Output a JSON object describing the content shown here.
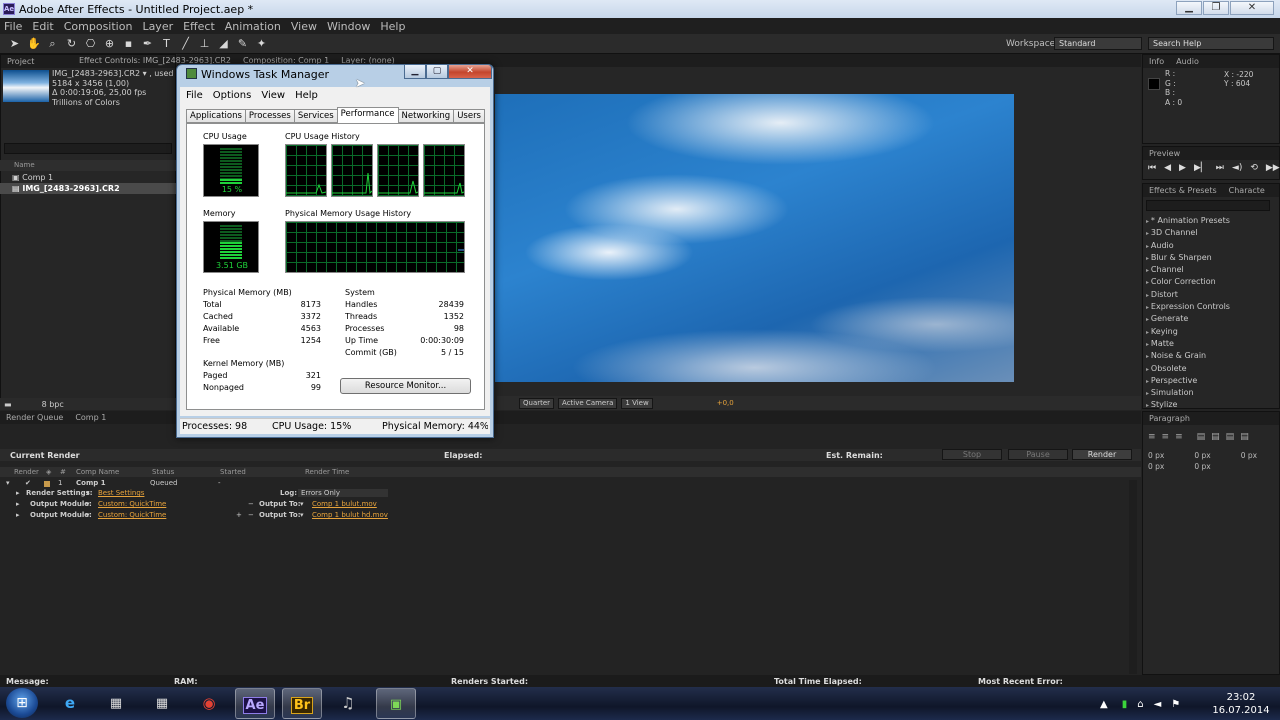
{
  "app": {
    "title": "Adobe After Effects - Untitled Project.aep *",
    "menu": [
      "File",
      "Edit",
      "Composition",
      "Layer",
      "Effect",
      "Animation",
      "View",
      "Window",
      "Help"
    ]
  },
  "toolbar": {
    "workspace_label": "Workspace:",
    "workspace_value": "Standard",
    "search_help": "Search Help"
  },
  "project": {
    "tab": "Project",
    "effect_controls_tab": "Effect Controls: IMG_[2483-2963].CR2",
    "composition_tab": "Composition: Comp 1",
    "layer_tab": "Layer: (none)",
    "file_name": "IMG_[2483-2963].CR2 ▾ , used 1",
    "file_dims": "5184 x 3456 (1,00)",
    "file_duration": "Δ 0:00:19:06, 25,00 fps",
    "file_colors": "Trillions of Colors",
    "list_header": "Name",
    "items": [
      {
        "label": "Comp 1",
        "selected": false
      },
      {
        "label": "IMG_[2483-2963].CR2",
        "selected": true
      }
    ],
    "bpc": "8 bpc"
  },
  "comp_bar": {
    "resolution": "Quarter",
    "camera": "Active Camera",
    "views": "1 View",
    "exposure": "+0,0"
  },
  "info": {
    "tab": "Info",
    "audio_tab": "Audio",
    "r": "R :",
    "g": "G :",
    "b": "B :",
    "a": "A : 0",
    "x": "X : -220",
    "y": "Y : 604"
  },
  "preview": {
    "tab": "Preview"
  },
  "effects": {
    "tab": "Effects & Presets",
    "char_tab": "Characte",
    "items": [
      "* Animation Presets",
      "3D Channel",
      "Audio",
      "Blur & Sharpen",
      "Channel",
      "Color Correction",
      "Distort",
      "Expression Controls",
      "Generate",
      "Keying",
      "Matte",
      "Noise & Grain",
      "Obsolete",
      "Perspective",
      "Simulation",
      "Stylize"
    ]
  },
  "paragraph": {
    "tab": "Paragraph",
    "values": [
      "0 px",
      "0 px",
      "0 px",
      "0 px",
      "0 px"
    ]
  },
  "render_queue": {
    "tab": "Render Queue",
    "comp_tab": "Comp 1",
    "current_render": "Current Render",
    "elapsed": "Elapsed:",
    "est_remain": "Est. Remain:",
    "stop": "Stop",
    "pause": "Pause",
    "render": "Render",
    "headers": [
      "Render",
      "#",
      "Comp Name",
      "Status",
      "Started",
      "Render Time"
    ],
    "item": {
      "num": "1",
      "comp": "Comp 1",
      "status": "Queued",
      "started": "-"
    },
    "render_settings_label": "Render Settings:",
    "render_settings_value": "Best Settings",
    "log_label": "Log:",
    "log_value": "Errors Only",
    "output_module_label": "Output Module:",
    "output_module_value": "Custom: QuickTime",
    "output_to_label": "Output To:",
    "output_to_1": "Comp 1 bulut.mov",
    "output_to_2": "Comp 1 bulut hd.mov"
  },
  "status": {
    "message": "Message:",
    "ram": "RAM:",
    "renders_started": "Renders Started:",
    "total_time": "Total Time Elapsed:",
    "recent_error": "Most Recent Error:"
  },
  "task_manager": {
    "title": "Windows Task Manager",
    "menu": [
      "File",
      "Options",
      "View",
      "Help"
    ],
    "tabs": [
      "Applications",
      "Processes",
      "Services",
      "Performance",
      "Networking",
      "Users"
    ],
    "active_tab": "Performance",
    "cpu_usage_label": "CPU Usage",
    "cpu_usage_value": "15 %",
    "cpu_usage_percent": 15,
    "cpu_history_label": "CPU Usage History",
    "memory_label": "Memory",
    "memory_value": "3.51 GB",
    "mem_history_label": "Physical Memory Usage History",
    "phys_mem_title": "Physical Memory (MB)",
    "phys_mem": [
      [
        "Total",
        "8173"
      ],
      [
        "Cached",
        "3372"
      ],
      [
        "Available",
        "4563"
      ],
      [
        "Free",
        "1254"
      ]
    ],
    "system_title": "System",
    "system": [
      [
        "Handles",
        "28439"
      ],
      [
        "Threads",
        "1352"
      ],
      [
        "Processes",
        "98"
      ],
      [
        "Up Time",
        "0:00:30:09"
      ],
      [
        "Commit (GB)",
        "5 / 15"
      ]
    ],
    "kernel_title": "Kernel Memory (MB)",
    "kernel": [
      [
        "Paged",
        "321"
      ],
      [
        "Nonpaged",
        "99"
      ]
    ],
    "resource_monitor": "Resource Monitor...",
    "status_processes": "Processes: 98",
    "status_cpu": "CPU Usage: 15%",
    "status_memory": "Physical Memory: 44%"
  },
  "taskbar": {
    "apps": [
      "ie-icon",
      "calculator-icon",
      "calculator-icon",
      "chrome-icon",
      "after-effects-icon",
      "bridge-icon",
      "media-icon",
      "task-manager-icon"
    ],
    "ae_label": "Ae",
    "br_label": "Br",
    "time": "23:02",
    "date": "16.07.2014"
  },
  "colors": {
    "ae_panel": "#262626",
    "ae_accent_orange": "#e7a33b",
    "tm_graph_green": "#1fd33a"
  }
}
